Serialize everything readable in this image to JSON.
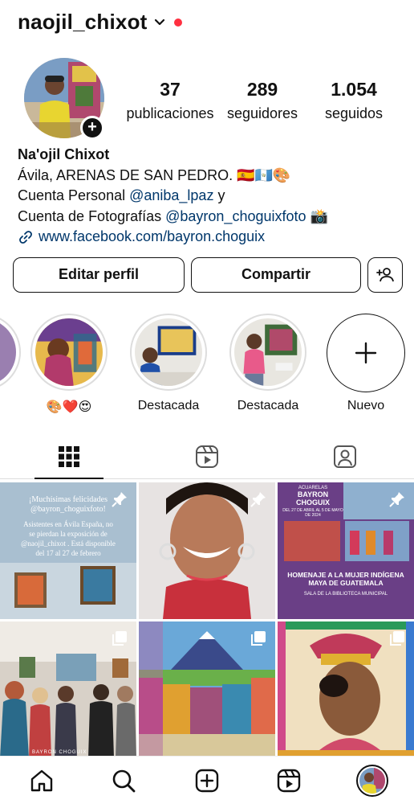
{
  "header": {
    "username": "naojil_chixot",
    "dropdown_icon": "chevron-down-icon",
    "notification_color": "#ff3040"
  },
  "profile": {
    "stats": [
      {
        "value": "37",
        "label": "publicaciones"
      },
      {
        "value": "289",
        "label": "seguidores"
      },
      {
        "value": "1.054",
        "label": "seguidos"
      }
    ],
    "add_story_icon": "plus-icon"
  },
  "bio": {
    "name": "Na'ojil Chixot",
    "line1": "Ávila, ARENAS DE SAN PEDRO. 🇪🇸🇬🇹🎨",
    "line2_prefix": "Cuenta Personal ",
    "line2_mention": "@aniba_lpaz",
    "line2_suffix": " y",
    "line3_prefix": "Cuenta de Fotografías ",
    "line3_mention": "@bayron_choguixfoto",
    "line3_suffix": " 📸",
    "link": "www.facebook.com/bayron.choguix",
    "link_icon": "link-icon",
    "link_color": "#00376b"
  },
  "actions": {
    "edit": "Editar perfil",
    "share": "Compartir",
    "discover_icon": "add-person-icon"
  },
  "highlights": [
    {
      "label": "🎨❤️😍"
    },
    {
      "label": "Destacada"
    },
    {
      "label": "Destacada"
    },
    {
      "label": "Nuevo"
    }
  ],
  "tabs": [
    {
      "icon": "grid-icon",
      "active": true
    },
    {
      "icon": "reels-icon",
      "active": false
    },
    {
      "icon": "tagged-icon",
      "active": false
    }
  ],
  "posts": {
    "post1": {
      "line1": "¡Muchísimas felicidades",
      "line2": "@bayron_choguixfoto!",
      "line3": "Asistentes en Ávila España, no",
      "line4": "se pierdan la exposición de",
      "line5": "@naojil_chixot . Está disponible",
      "line6": "del 17 al 27 de febrero"
    },
    "post3": {
      "kicker": "ACUARELAS",
      "title": "BAYRON CHOGUIX",
      "dates": "DEL 27 DE ABRIL AL 5 DE MAYO DE 2024",
      "headline1": "HOMENAJE A LA MUJER INDÍGENA",
      "headline2": "MAYA DE GUATEMALA",
      "venue": "SALA DE LA BIBLIOTECA MUNICIPAL"
    },
    "post4": {
      "watermark": "BAYRON CHOGUIX"
    },
    "pin_icon": "pin-icon",
    "multi_icon": "carousel-icon"
  },
  "bottom_nav": [
    {
      "icon": "home-icon"
    },
    {
      "icon": "search-icon"
    },
    {
      "icon": "create-icon"
    },
    {
      "icon": "reels-icon"
    },
    {
      "icon": "profile-avatar"
    }
  ]
}
